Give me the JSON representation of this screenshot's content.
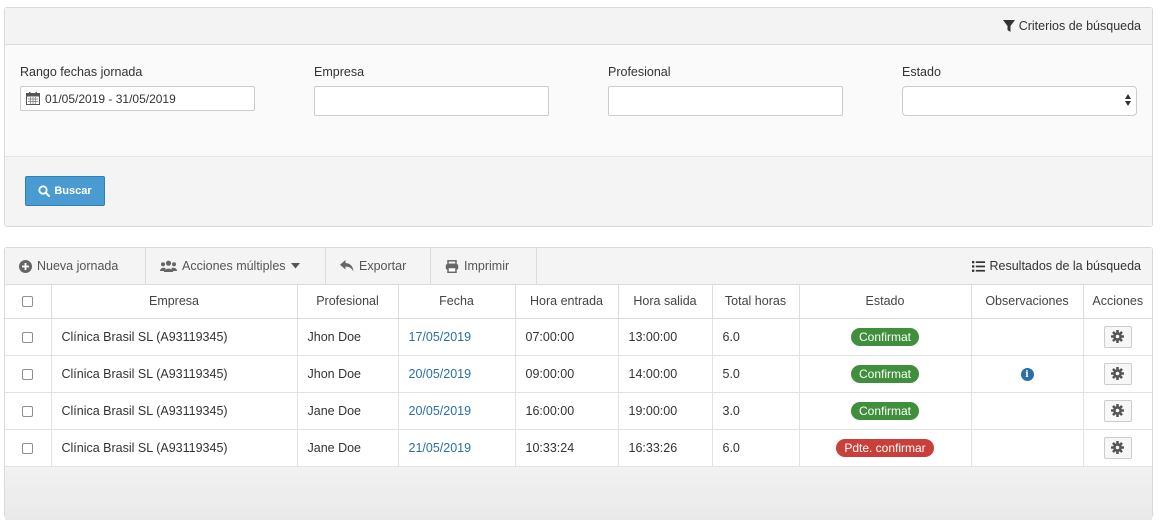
{
  "search": {
    "header_label": "Criterios de búsqueda",
    "fields": {
      "date_range_label": "Rango fechas jornada",
      "date_range_value": "01/05/2019 - 31/05/2019",
      "company_label": "Empresa",
      "company_value": "",
      "professional_label": "Profesional",
      "professional_value": "",
      "status_label": "Estado",
      "status_value": ""
    },
    "search_button": "Buscar"
  },
  "results": {
    "header_label": "Resultados de la búsqueda",
    "toolbar": {
      "new_shift": "Nueva jornada",
      "multiple_actions": "Acciones múltiples",
      "export": "Exportar",
      "print": "Imprimir"
    },
    "columns": [
      "Empresa",
      "Profesional",
      "Fecha",
      "Hora entrada",
      "Hora salida",
      "Total horas",
      "Estado",
      "Observaciones",
      "Acciones"
    ],
    "rows": [
      {
        "company": "Clínica Brasil SL (A93119345)",
        "professional": "Jhon Doe",
        "date": "17/05/2019",
        "entry": "07:00:00",
        "exit": "13:00:00",
        "total": "6.0",
        "status": "Confirmat",
        "status_color": "#3f8f3c",
        "has_observation": false
      },
      {
        "company": "Clínica Brasil SL (A93119345)",
        "professional": "Jhon Doe",
        "date": "20/05/2019",
        "entry": "09:00:00",
        "exit": "14:00:00",
        "total": "5.0",
        "status": "Confirmat",
        "status_color": "#3f8f3c",
        "has_observation": true
      },
      {
        "company": "Clínica Brasil SL (A93119345)",
        "professional": "Jane Doe",
        "date": "20/05/2019",
        "entry": "16:00:00",
        "exit": "19:00:00",
        "total": "3.0",
        "status": "Confirmat",
        "status_color": "#3f8f3c",
        "has_observation": false
      },
      {
        "company": "Clínica Brasil SL (A93119345)",
        "professional": "Jane Doe",
        "date": "21/05/2019",
        "entry": "10:33:24",
        "exit": "16:33:26",
        "total": "6.0",
        "status": "Pdte. confirmar",
        "status_color": "#c9403a",
        "has_observation": false
      }
    ]
  },
  "colors": {
    "primary_button": "#4a9bd2",
    "link": "#2a6fa8",
    "confirmed": "#3f8f3c",
    "pending": "#c9403a"
  },
  "icons": {
    "filter": "filter-icon",
    "calendar": "calendar-icon",
    "search": "search-icon",
    "plus": "plus-circle-icon",
    "users": "users-icon",
    "export": "reply-arrow-icon",
    "print": "printer-icon",
    "list": "list-icon",
    "info": "info-icon",
    "gear": "gear-icon"
  }
}
